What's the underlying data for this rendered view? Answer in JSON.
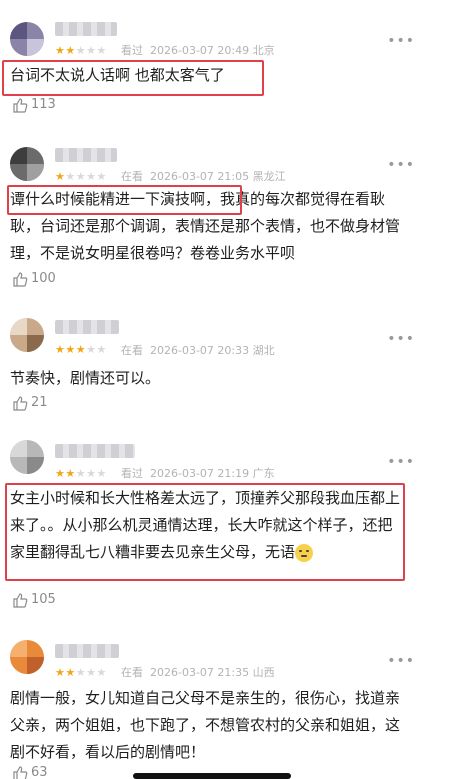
{
  "comments": [
    {
      "stars": 2,
      "status": "看过",
      "datetime": "2026-03-07 20:49",
      "location": "北京",
      "text": "台词不太说人话啊 也都太客气了",
      "likes": "113"
    },
    {
      "stars": 1,
      "status": "在看",
      "datetime": "2026-03-07 21:05",
      "location": "黑龙江",
      "text": "谭什么时候能精进一下演技啊，我真的每次都觉得在看耿耿，台词还是那个调调，表情还是那个表情，也不做身材管理，不是说女明星很卷吗？卷卷业务水平呗",
      "likes": "100"
    },
    {
      "stars": 3,
      "status": "在看",
      "datetime": "2026-03-07 20:33",
      "location": "湖北",
      "text": "节奏快，剧情还可以。",
      "likes": "21"
    },
    {
      "stars": 2,
      "status": "看过",
      "datetime": "2026-03-07 21:19",
      "location": "广东",
      "text": "女主小时候和长大性格差太远了，顶撞养父那段我血压都上来了。。从小那么机灵通情达理，长大咋就这个样子，还把家里翻得乱七八糟非要去见亲生父母，无语",
      "likes": "105"
    },
    {
      "stars": 2,
      "status": "在看",
      "datetime": "2026-03-07 21:35",
      "location": "山西",
      "text": "剧情一般，女儿知道自己父母不是亲生的，很伤心，找道亲父亲，两个姐姐，也下跑了，不想管农村的父亲和姐姐，这剧不好看，看以后的剧情吧！",
      "likes": "63"
    }
  ],
  "colors": {
    "star_on": "#f2a615",
    "star_off": "#d9d9d9",
    "highlight_box": "#e0404a"
  },
  "icons": {
    "like": "thumbs-up-icon",
    "more": "more-dots-icon",
    "emoji": "speechless-emoji-icon"
  }
}
